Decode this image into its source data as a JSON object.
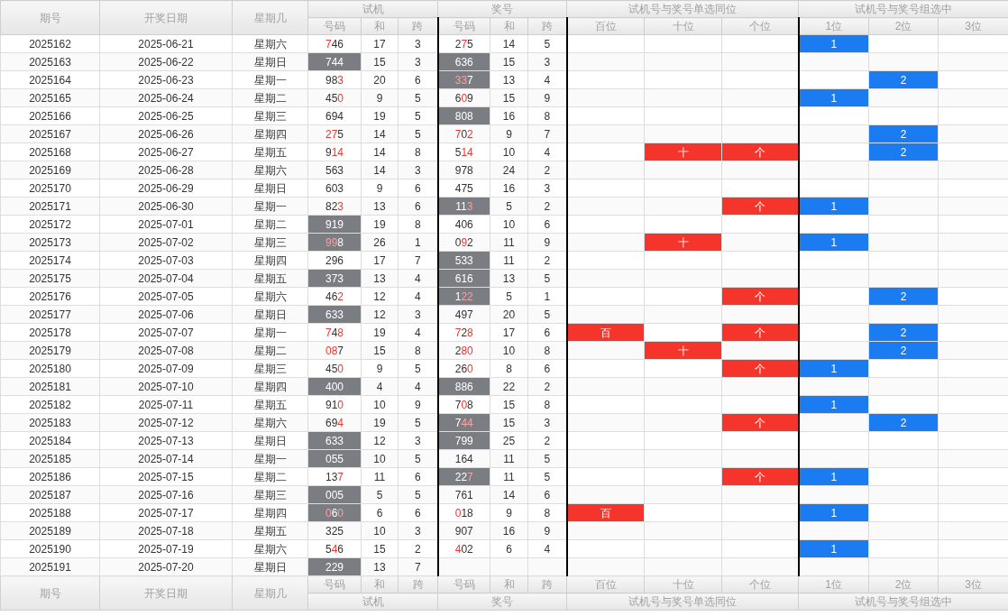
{
  "header": {
    "fixed": [
      "期号",
      "开奖日期",
      "星期几"
    ],
    "groups": [
      {
        "title": "试机",
        "columns": [
          "号码",
          "和",
          "跨"
        ]
      },
      {
        "title": "奖号",
        "columns": [
          "号码",
          "和",
          "跨"
        ]
      },
      {
        "title": "试机号与奖号单选同位",
        "columns": [
          "百位",
          "十位",
          "个位"
        ]
      },
      {
        "title": "试机号与奖号组选中",
        "columns": [
          "1位",
          "2位",
          "3位"
        ]
      }
    ]
  },
  "rows": [
    {
      "issue": "2025162",
      "date": "2025-06-21",
      "weekday": "星期六",
      "trial": {
        "number": "746",
        "hits": [
          true,
          false,
          false
        ],
        "shaded": false,
        "sum": "17",
        "span": "3"
      },
      "draw": {
        "number": "275",
        "hits": [
          false,
          true,
          false
        ],
        "shaded": false,
        "sum": "14",
        "span": "5"
      },
      "same_position": [],
      "group_hits": [
        {
          "kind": "pos1",
          "label": "1"
        }
      ]
    },
    {
      "issue": "2025163",
      "date": "2025-06-22",
      "weekday": "星期日",
      "trial": {
        "number": "744",
        "hits": [
          false,
          false,
          false
        ],
        "shaded": true,
        "sum": "15",
        "span": "3"
      },
      "draw": {
        "number": "636",
        "hits": [
          false,
          false,
          false
        ],
        "shaded": true,
        "sum": "15",
        "span": "3"
      },
      "same_position": [],
      "group_hits": []
    },
    {
      "issue": "2025164",
      "date": "2025-06-23",
      "weekday": "星期一",
      "trial": {
        "number": "983",
        "hits": [
          false,
          false,
          true
        ],
        "shaded": false,
        "sum": "20",
        "span": "6"
      },
      "draw": {
        "number": "337",
        "hits": [
          true,
          true,
          false
        ],
        "shaded": true,
        "sum": "13",
        "span": "4"
      },
      "same_position": [],
      "group_hits": [
        {
          "kind": "pos2",
          "label": "2"
        }
      ]
    },
    {
      "issue": "2025165",
      "date": "2025-06-24",
      "weekday": "星期二",
      "trial": {
        "number": "450",
        "hits": [
          false,
          false,
          true
        ],
        "shaded": false,
        "sum": "9",
        "span": "5"
      },
      "draw": {
        "number": "609",
        "hits": [
          false,
          true,
          false
        ],
        "shaded": false,
        "sum": "15",
        "span": "9"
      },
      "same_position": [],
      "group_hits": [
        {
          "kind": "pos1",
          "label": "1"
        }
      ]
    },
    {
      "issue": "2025166",
      "date": "2025-06-25",
      "weekday": "星期三",
      "trial": {
        "number": "694",
        "hits": [
          false,
          false,
          false
        ],
        "shaded": false,
        "sum": "19",
        "span": "5"
      },
      "draw": {
        "number": "808",
        "hits": [
          false,
          false,
          false
        ],
        "shaded": true,
        "sum": "16",
        "span": "8"
      },
      "same_position": [],
      "group_hits": []
    },
    {
      "issue": "2025167",
      "date": "2025-06-26",
      "weekday": "星期四",
      "trial": {
        "number": "275",
        "hits": [
          true,
          true,
          false
        ],
        "shaded": false,
        "sum": "14",
        "span": "5"
      },
      "draw": {
        "number": "702",
        "hits": [
          true,
          false,
          true
        ],
        "shaded": false,
        "sum": "9",
        "span": "7"
      },
      "same_position": [],
      "group_hits": [
        {
          "kind": "pos2",
          "label": "2"
        }
      ]
    },
    {
      "issue": "2025168",
      "date": "2025-06-27",
      "weekday": "星期五",
      "trial": {
        "number": "914",
        "hits": [
          false,
          true,
          true
        ],
        "shaded": false,
        "sum": "14",
        "span": "8"
      },
      "draw": {
        "number": "514",
        "hits": [
          false,
          true,
          true
        ],
        "shaded": false,
        "sum": "10",
        "span": "4"
      },
      "same_position": [
        {
          "kind": "tens",
          "label": "十"
        },
        {
          "kind": "ones",
          "label": "个"
        }
      ],
      "group_hits": [
        {
          "kind": "pos2",
          "label": "2"
        }
      ]
    },
    {
      "issue": "2025169",
      "date": "2025-06-28",
      "weekday": "星期六",
      "trial": {
        "number": "563",
        "hits": [
          false,
          false,
          false
        ],
        "shaded": false,
        "sum": "14",
        "span": "3"
      },
      "draw": {
        "number": "978",
        "hits": [
          false,
          false,
          false
        ],
        "shaded": false,
        "sum": "24",
        "span": "2"
      },
      "same_position": [],
      "group_hits": []
    },
    {
      "issue": "2025170",
      "date": "2025-06-29",
      "weekday": "星期日",
      "trial": {
        "number": "603",
        "hits": [
          false,
          false,
          false
        ],
        "shaded": false,
        "sum": "9",
        "span": "6"
      },
      "draw": {
        "number": "475",
        "hits": [
          false,
          false,
          false
        ],
        "shaded": false,
        "sum": "16",
        "span": "3"
      },
      "same_position": [],
      "group_hits": []
    },
    {
      "issue": "2025171",
      "date": "2025-06-30",
      "weekday": "星期一",
      "trial": {
        "number": "823",
        "hits": [
          false,
          false,
          true
        ],
        "shaded": false,
        "sum": "13",
        "span": "6"
      },
      "draw": {
        "number": "113",
        "hits": [
          false,
          false,
          true
        ],
        "shaded": true,
        "sum": "5",
        "span": "2"
      },
      "same_position": [
        {
          "kind": "ones",
          "label": "个"
        }
      ],
      "group_hits": [
        {
          "kind": "pos1",
          "label": "1"
        }
      ]
    },
    {
      "issue": "2025172",
      "date": "2025-07-01",
      "weekday": "星期二",
      "trial": {
        "number": "919",
        "hits": [
          false,
          false,
          false
        ],
        "shaded": true,
        "sum": "19",
        "span": "8"
      },
      "draw": {
        "number": "406",
        "hits": [
          false,
          false,
          false
        ],
        "shaded": false,
        "sum": "10",
        "span": "6"
      },
      "same_position": [],
      "group_hits": []
    },
    {
      "issue": "2025173",
      "date": "2025-07-02",
      "weekday": "星期三",
      "trial": {
        "number": "998",
        "hits": [
          true,
          true,
          false
        ],
        "shaded": true,
        "sum": "26",
        "span": "1"
      },
      "draw": {
        "number": "092",
        "hits": [
          false,
          true,
          false
        ],
        "shaded": false,
        "sum": "11",
        "span": "9"
      },
      "same_position": [
        {
          "kind": "tens",
          "label": "十"
        }
      ],
      "group_hits": [
        {
          "kind": "pos1",
          "label": "1"
        }
      ]
    },
    {
      "issue": "2025174",
      "date": "2025-07-03",
      "weekday": "星期四",
      "trial": {
        "number": "296",
        "hits": [
          false,
          false,
          false
        ],
        "shaded": false,
        "sum": "17",
        "span": "7"
      },
      "draw": {
        "number": "533",
        "hits": [
          false,
          false,
          false
        ],
        "shaded": true,
        "sum": "11",
        "span": "2"
      },
      "same_position": [],
      "group_hits": []
    },
    {
      "issue": "2025175",
      "date": "2025-07-04",
      "weekday": "星期五",
      "trial": {
        "number": "373",
        "hits": [
          false,
          false,
          false
        ],
        "shaded": true,
        "sum": "13",
        "span": "4"
      },
      "draw": {
        "number": "616",
        "hits": [
          false,
          false,
          false
        ],
        "shaded": true,
        "sum": "13",
        "span": "5"
      },
      "same_position": [],
      "group_hits": []
    },
    {
      "issue": "2025176",
      "date": "2025-07-05",
      "weekday": "星期六",
      "trial": {
        "number": "462",
        "hits": [
          false,
          false,
          true
        ],
        "shaded": false,
        "sum": "12",
        "span": "4"
      },
      "draw": {
        "number": "122",
        "hits": [
          false,
          true,
          true
        ],
        "shaded": true,
        "sum": "5",
        "span": "1"
      },
      "same_position": [
        {
          "kind": "ones",
          "label": "个"
        }
      ],
      "group_hits": [
        {
          "kind": "pos2",
          "label": "2"
        }
      ]
    },
    {
      "issue": "2025177",
      "date": "2025-07-06",
      "weekday": "星期日",
      "trial": {
        "number": "633",
        "hits": [
          false,
          false,
          false
        ],
        "shaded": true,
        "sum": "12",
        "span": "3"
      },
      "draw": {
        "number": "497",
        "hits": [
          false,
          false,
          false
        ],
        "shaded": false,
        "sum": "20",
        "span": "5"
      },
      "same_position": [],
      "group_hits": []
    },
    {
      "issue": "2025178",
      "date": "2025-07-07",
      "weekday": "星期一",
      "trial": {
        "number": "748",
        "hits": [
          true,
          false,
          true
        ],
        "shaded": false,
        "sum": "19",
        "span": "4"
      },
      "draw": {
        "number": "728",
        "hits": [
          true,
          false,
          true
        ],
        "shaded": false,
        "sum": "17",
        "span": "6"
      },
      "same_position": [
        {
          "kind": "hundreds",
          "label": "百"
        },
        {
          "kind": "ones",
          "label": "个"
        }
      ],
      "group_hits": [
        {
          "kind": "pos2",
          "label": "2"
        }
      ]
    },
    {
      "issue": "2025179",
      "date": "2025-07-08",
      "weekday": "星期二",
      "trial": {
        "number": "087",
        "hits": [
          true,
          true,
          false
        ],
        "shaded": false,
        "sum": "15",
        "span": "8"
      },
      "draw": {
        "number": "280",
        "hits": [
          false,
          true,
          true
        ],
        "shaded": false,
        "sum": "10",
        "span": "8"
      },
      "same_position": [
        {
          "kind": "tens",
          "label": "十"
        }
      ],
      "group_hits": [
        {
          "kind": "pos2",
          "label": "2"
        }
      ]
    },
    {
      "issue": "2025180",
      "date": "2025-07-09",
      "weekday": "星期三",
      "trial": {
        "number": "450",
        "hits": [
          false,
          false,
          true
        ],
        "shaded": false,
        "sum": "9",
        "span": "5"
      },
      "draw": {
        "number": "260",
        "hits": [
          false,
          false,
          true
        ],
        "shaded": false,
        "sum": "8",
        "span": "6"
      },
      "same_position": [
        {
          "kind": "ones",
          "label": "个"
        }
      ],
      "group_hits": [
        {
          "kind": "pos1",
          "label": "1"
        }
      ]
    },
    {
      "issue": "2025181",
      "date": "2025-07-10",
      "weekday": "星期四",
      "trial": {
        "number": "400",
        "hits": [
          false,
          false,
          false
        ],
        "shaded": true,
        "sum": "4",
        "span": "4"
      },
      "draw": {
        "number": "886",
        "hits": [
          false,
          false,
          false
        ],
        "shaded": true,
        "sum": "22",
        "span": "2"
      },
      "same_position": [],
      "group_hits": []
    },
    {
      "issue": "2025182",
      "date": "2025-07-11",
      "weekday": "星期五",
      "trial": {
        "number": "910",
        "hits": [
          false,
          false,
          true
        ],
        "shaded": false,
        "sum": "10",
        "span": "9"
      },
      "draw": {
        "number": "708",
        "hits": [
          false,
          true,
          false
        ],
        "shaded": false,
        "sum": "15",
        "span": "8"
      },
      "same_position": [],
      "group_hits": [
        {
          "kind": "pos1",
          "label": "1"
        }
      ]
    },
    {
      "issue": "2025183",
      "date": "2025-07-12",
      "weekday": "星期六",
      "trial": {
        "number": "694",
        "hits": [
          false,
          false,
          true
        ],
        "shaded": false,
        "sum": "19",
        "span": "5"
      },
      "draw": {
        "number": "744",
        "hits": [
          false,
          true,
          true
        ],
        "shaded": true,
        "sum": "15",
        "span": "3"
      },
      "same_position": [
        {
          "kind": "ones",
          "label": "个"
        }
      ],
      "group_hits": [
        {
          "kind": "pos2",
          "label": "2"
        }
      ]
    },
    {
      "issue": "2025184",
      "date": "2025-07-13",
      "weekday": "星期日",
      "trial": {
        "number": "633",
        "hits": [
          false,
          false,
          false
        ],
        "shaded": true,
        "sum": "12",
        "span": "3"
      },
      "draw": {
        "number": "799",
        "hits": [
          false,
          false,
          false
        ],
        "shaded": true,
        "sum": "25",
        "span": "2"
      },
      "same_position": [],
      "group_hits": []
    },
    {
      "issue": "2025185",
      "date": "2025-07-14",
      "weekday": "星期一",
      "trial": {
        "number": "055",
        "hits": [
          false,
          false,
          false
        ],
        "shaded": true,
        "sum": "10",
        "span": "5"
      },
      "draw": {
        "number": "164",
        "hits": [
          false,
          false,
          false
        ],
        "shaded": false,
        "sum": "11",
        "span": "5"
      },
      "same_position": [],
      "group_hits": []
    },
    {
      "issue": "2025186",
      "date": "2025-07-15",
      "weekday": "星期二",
      "trial": {
        "number": "137",
        "hits": [
          false,
          false,
          true
        ],
        "shaded": false,
        "sum": "11",
        "span": "6"
      },
      "draw": {
        "number": "227",
        "hits": [
          false,
          false,
          true
        ],
        "shaded": true,
        "sum": "11",
        "span": "5"
      },
      "same_position": [
        {
          "kind": "ones",
          "label": "个"
        }
      ],
      "group_hits": [
        {
          "kind": "pos1",
          "label": "1"
        }
      ]
    },
    {
      "issue": "2025187",
      "date": "2025-07-16",
      "weekday": "星期三",
      "trial": {
        "number": "005",
        "hits": [
          false,
          false,
          false
        ],
        "shaded": true,
        "sum": "5",
        "span": "5"
      },
      "draw": {
        "number": "761",
        "hits": [
          false,
          false,
          false
        ],
        "shaded": false,
        "sum": "14",
        "span": "6"
      },
      "same_position": [],
      "group_hits": []
    },
    {
      "issue": "2025188",
      "date": "2025-07-17",
      "weekday": "星期四",
      "trial": {
        "number": "060",
        "hits": [
          true,
          false,
          true
        ],
        "shaded": true,
        "sum": "6",
        "span": "6"
      },
      "draw": {
        "number": "018",
        "hits": [
          true,
          false,
          false
        ],
        "shaded": false,
        "sum": "9",
        "span": "8"
      },
      "same_position": [
        {
          "kind": "hundreds",
          "label": "百"
        }
      ],
      "group_hits": [
        {
          "kind": "pos1",
          "label": "1"
        }
      ]
    },
    {
      "issue": "2025189",
      "date": "2025-07-18",
      "weekday": "星期五",
      "trial": {
        "number": "325",
        "hits": [
          false,
          false,
          false
        ],
        "shaded": false,
        "sum": "10",
        "span": "3"
      },
      "draw": {
        "number": "907",
        "hits": [
          false,
          false,
          false
        ],
        "shaded": false,
        "sum": "16",
        "span": "9"
      },
      "same_position": [],
      "group_hits": []
    },
    {
      "issue": "2025190",
      "date": "2025-07-19",
      "weekday": "星期六",
      "trial": {
        "number": "546",
        "hits": [
          false,
          true,
          false
        ],
        "shaded": false,
        "sum": "15",
        "span": "2"
      },
      "draw": {
        "number": "402",
        "hits": [
          true,
          false,
          false
        ],
        "shaded": false,
        "sum": "6",
        "span": "4"
      },
      "same_position": [],
      "group_hits": [
        {
          "kind": "pos1",
          "label": "1"
        }
      ]
    },
    {
      "issue": "2025191",
      "date": "2025-07-20",
      "weekday": "星期日",
      "trial": {
        "number": "229",
        "hits": [
          false,
          false,
          false
        ],
        "shaded": true,
        "sum": "13",
        "span": "7"
      },
      "same_position": [],
      "group_hits": []
    }
  ],
  "footer": {
    "fixed": [
      "期号",
      "开奖日期",
      "星期几"
    ],
    "groups": [
      {
        "title": "试机",
        "columns": [
          "号码",
          "和",
          "跨"
        ]
      },
      {
        "title": "奖号",
        "columns": [
          "号码",
          "和",
          "跨"
        ]
      },
      {
        "title": "试机号与奖号单选同位",
        "columns": [
          "百位",
          "十位",
          "个位"
        ]
      },
      {
        "title": "试机号与奖号组选中",
        "columns": [
          "1位",
          "2位",
          "3位"
        ]
      }
    ]
  }
}
